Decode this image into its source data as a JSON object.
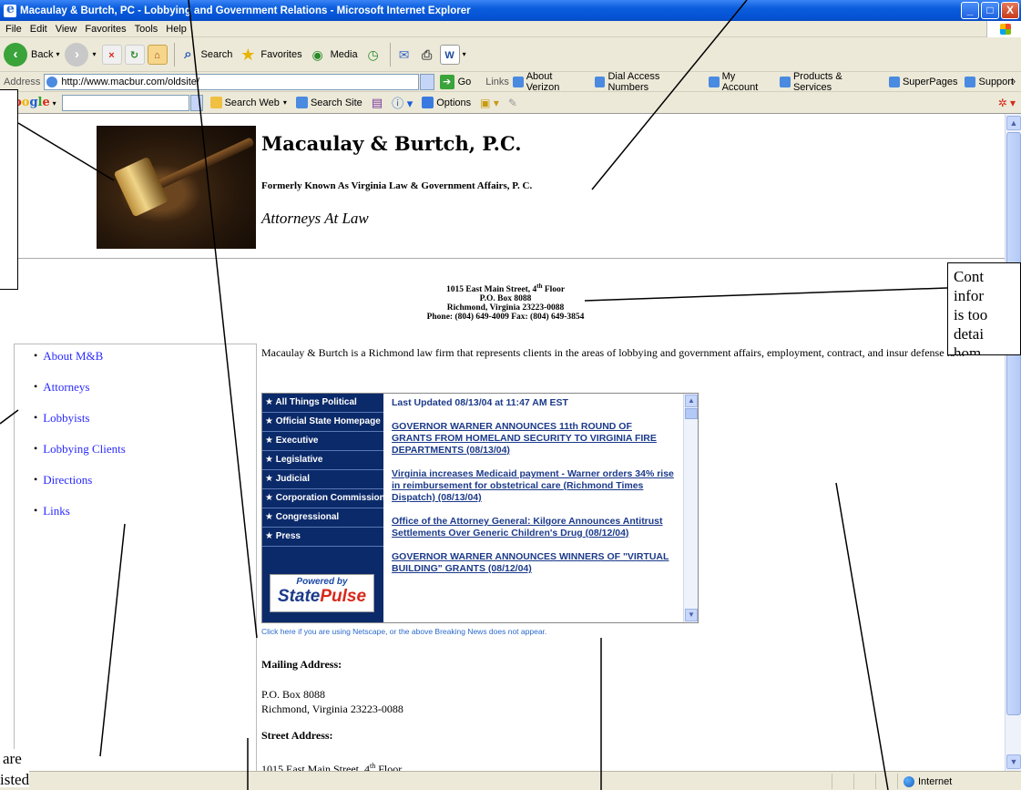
{
  "window": {
    "title": "Macaulay & Burtch, PC - Lobbying and Government Relations - Microsoft Internet Explorer",
    "min": "_",
    "max": "□",
    "close": "X"
  },
  "menu": [
    "File",
    "Edit",
    "View",
    "Favorites",
    "Tools",
    "Help"
  ],
  "toolbar": {
    "back": "Back",
    "search": "Search",
    "favorites": "Favorites",
    "media": "Media"
  },
  "address": {
    "label": "Address",
    "url": "http://www.macbur.com/oldsite/",
    "go": "Go",
    "links_label": "Links",
    "links": [
      "About Verizon",
      "Dial Access Numbers",
      "My Account",
      "Products & Services",
      "SuperPages",
      "Support"
    ]
  },
  "google": {
    "search_web": "Search Web",
    "search_site": "Search Site",
    "options": "Options"
  },
  "header": {
    "firm_name": "Macaulay & Burtch, P.C.",
    "formerly": "Formerly Known As Virginia Law & Government Affairs, P. C.",
    "tagline": "Attorneys At Law"
  },
  "contact": {
    "street_pre": "1015 East Main Street, 4",
    "street_sup": "th",
    "street_post": " Floor",
    "po": "P.O. Box 8088",
    "city": "Richmond, Virginia  23223-0088",
    "phone": "Phone: (804) 649-4009  Fax: (804) 649-3854"
  },
  "nav": [
    "About M&B",
    "Attorneys",
    "Lobbyists",
    "Lobbying Clients",
    "Directions",
    "Links"
  ],
  "intro": "Macaulay & Burtch is a Richmond law firm that represents clients in the areas of lobbying and government affairs, employment, contract, and insur defense law.",
  "news": {
    "categories": [
      "★ All Things Political",
      "★ Official State Homepage",
      "★ Executive",
      "★ Legislative",
      "★ Judicial",
      "★ Corporation Commission",
      "★ Congressional",
      "★ Press"
    ],
    "powered_by": "Powered by",
    "statepulse_a": "State",
    "statepulse_b": "Pulse",
    "updated": "Last Updated 08/13/04 at 11:47 AM EST",
    "items": [
      "GOVERNOR WARNER ANNOUNCES 11th ROUND OF GRANTS FROM HOMELAND SECURITY TO VIRGINIA FIRE DEPARTMENTS (08/13/04)",
      "Virginia increases Medicaid payment - Warner orders 34% rise in reimbursement for obstetrical care (Richmond Times Dispatch) (08/13/04)",
      "Office of the Attorney General: Kilgore Announces Antitrust Settlements Over Generic Children's Drug (08/12/04)",
      "GOVERNOR WARNER ANNOUNCES WINNERS OF \"VIRTUAL BUILDING\" GRANTS (08/12/04)"
    ]
  },
  "netscape_note": "Click here if you are using Netscape, or the above Breaking News does not appear.",
  "mailing": {
    "label": "Mailing Address:",
    "line1": "P.O. Box 8088",
    "line2": "Richmond, Virginia  23223-0088"
  },
  "street": {
    "label": "Street Address:",
    "line_pre": "1015 East Main Street, 4",
    "line_sup": "th",
    "line_post": " Floor"
  },
  "status": {
    "zone": "Internet"
  },
  "callouts": {
    "right": "Cont\ninfor\nis too\ndetai\nhom",
    "bottom_left_1": "are",
    "bottom_left_2": "isted"
  }
}
